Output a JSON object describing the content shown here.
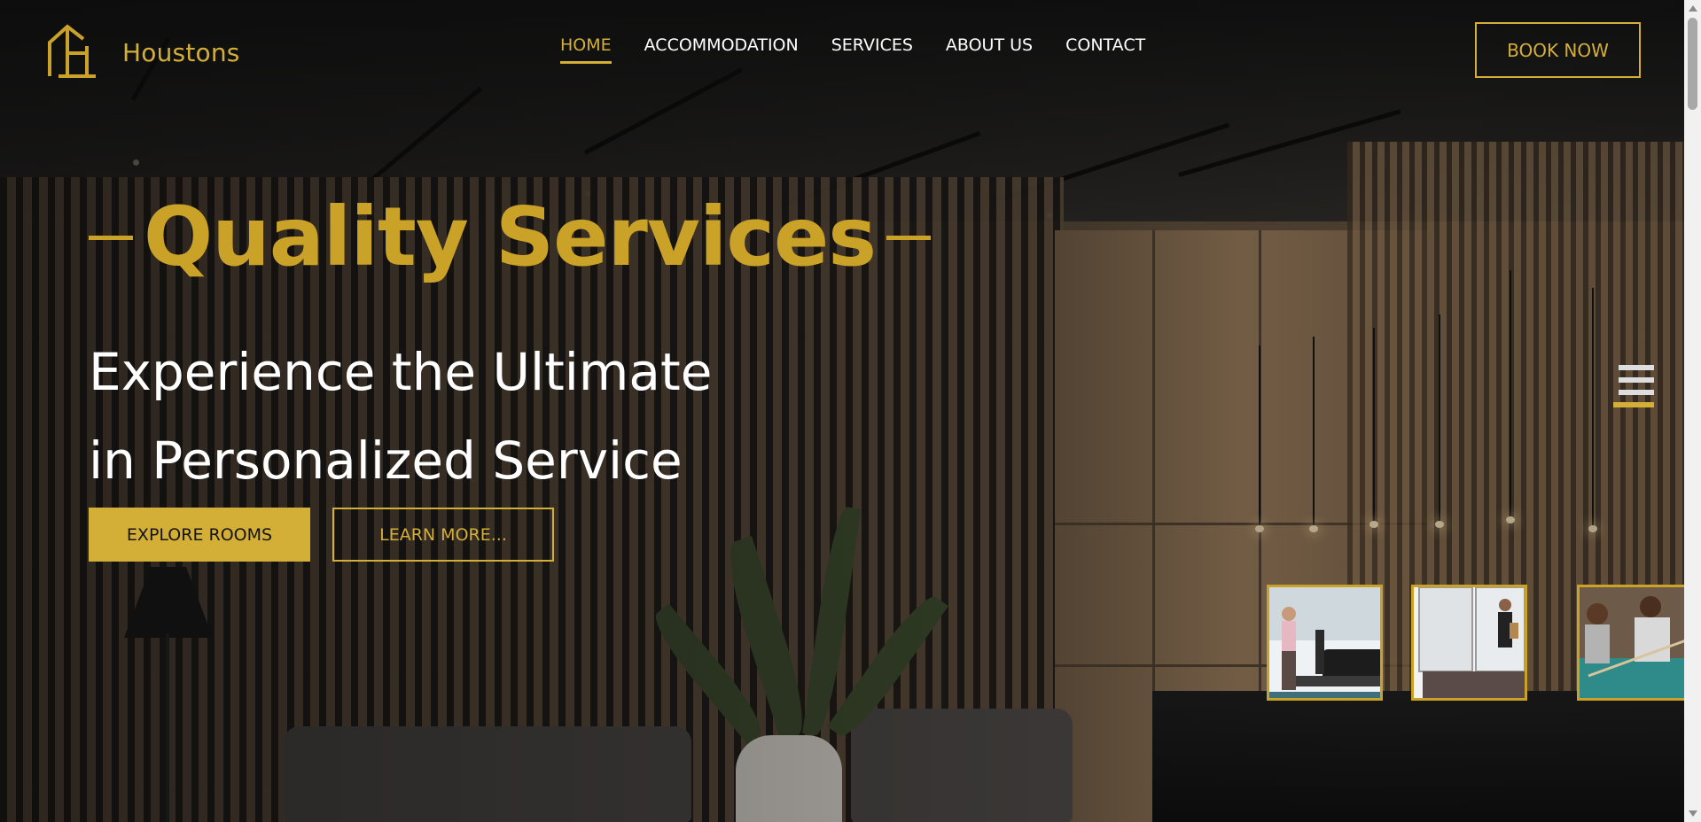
{
  "brand": {
    "name": "Houstons",
    "accent": "#d4af37",
    "logo_icon": "house-h-logo-icon"
  },
  "nav": {
    "items": [
      {
        "label": "HOME",
        "active": true
      },
      {
        "label": "ACCOMMODATION",
        "active": false
      },
      {
        "label": "SERVICES",
        "active": false
      },
      {
        "label": "ABOUT US",
        "active": false
      },
      {
        "label": "CONTACT",
        "active": false
      }
    ],
    "cta_label": "BOOK NOW"
  },
  "hero": {
    "eyebrow": "Quality Services",
    "headline_line1": "Experience the Ultimate",
    "headline_line2": "in Personalized Service",
    "primary_button": "EXPLORE ROOMS",
    "secondary_button": "LEARN MORE..."
  },
  "thumbnails": [
    {
      "icon": "gym-treadmill-image"
    },
    {
      "icon": "hotel-entrance-image"
    },
    {
      "icon": "billiards-image"
    }
  ],
  "menu_toggle_icon": "hamburger-menu-icon"
}
